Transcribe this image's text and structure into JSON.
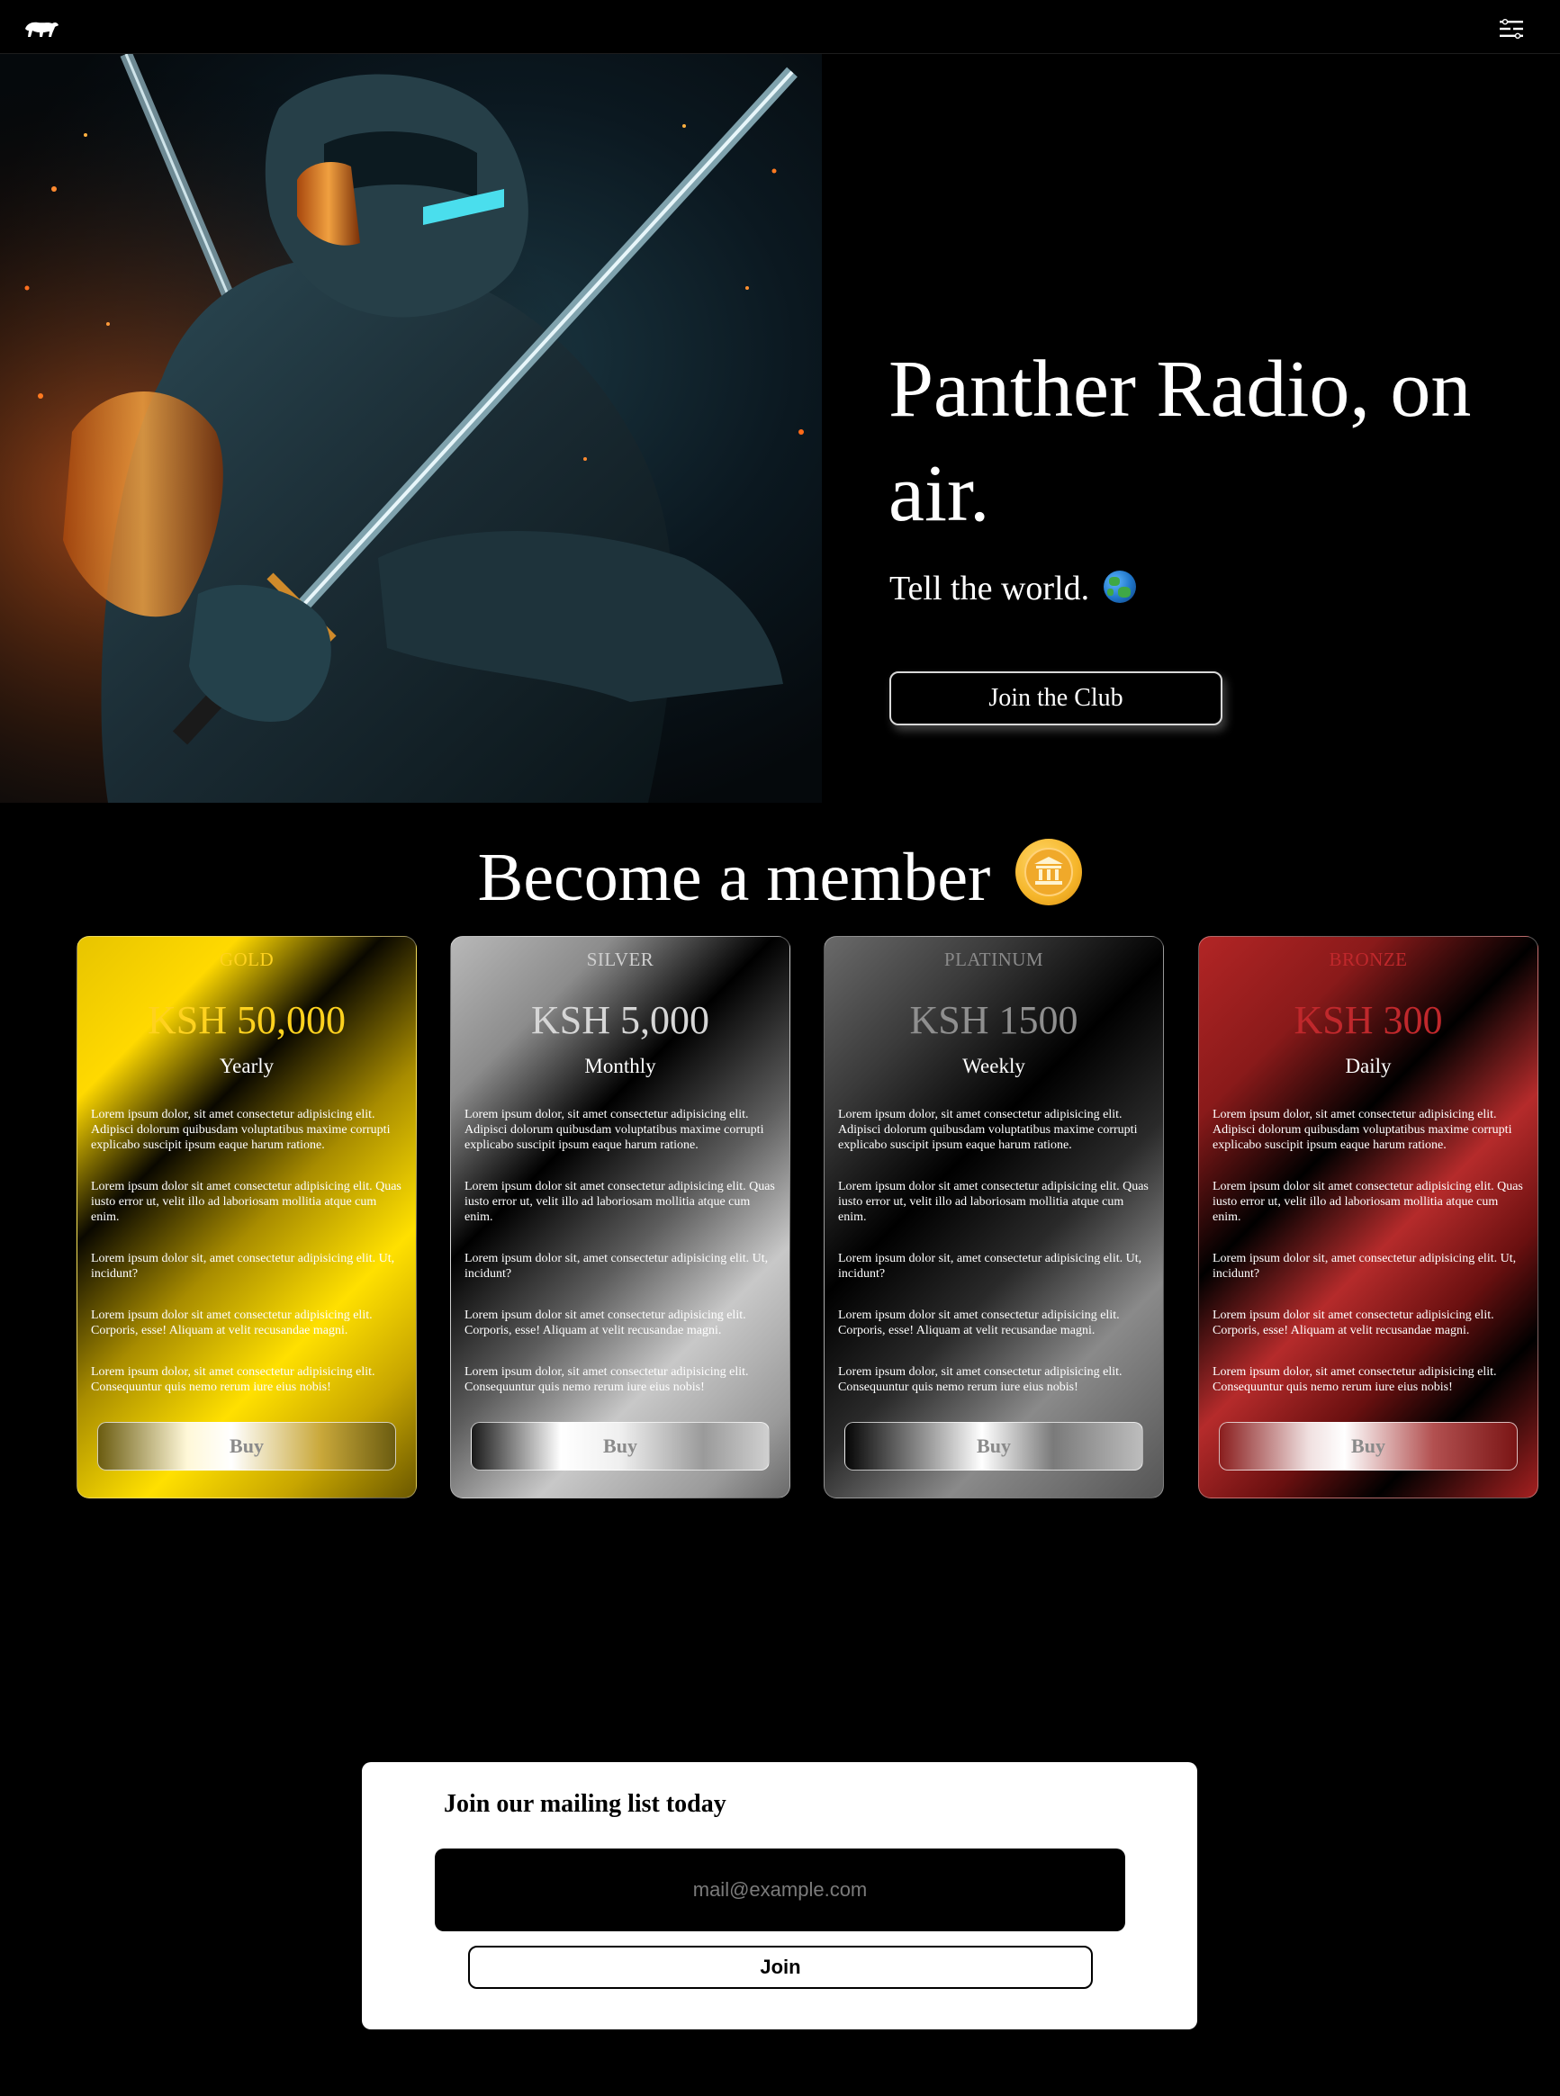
{
  "nav": {
    "logo_icon": "panther-logo-icon",
    "menu_icon": "menu-icon"
  },
  "hero": {
    "title": "Panther Radio, on air.",
    "subtitle": "Tell the world.",
    "subtitle_icon": "globe-icon",
    "cta_label": "Join the Club",
    "image_icon": "ninja-warrior-image"
  },
  "membership": {
    "title": "Become a member",
    "title_icon": "bank-coin-icon",
    "plans": [
      {
        "tier": "GOLD",
        "price": "KSH 50,000",
        "period": "Yearly",
        "color": "#ffd21f",
        "buy_label": "Buy",
        "paragraphs": [
          "Lorem ipsum dolor, sit amet consectetur adipisicing elit. Adipisci dolorum quibusdam voluptatibus maxime corrupti explicabo suscipit ipsum eaque harum ratione.",
          "Lorem ipsum dolor sit amet consectetur adipisicing elit. Quas iusto error ut, velit illo ad laboriosam mollitia atque cum enim.",
          "Lorem ipsum dolor sit, amet consectetur adipisicing elit. Ut, incidunt?",
          "Lorem ipsum dolor sit amet consectetur adipisicing elit. Corporis, esse! Aliquam at velit recusandae magni.",
          "Lorem ipsum dolor, sit amet consectetur adipisicing elit. Consequuntur quis nemo rerum iure eius nobis!"
        ]
      },
      {
        "tier": "SILVER",
        "price": "KSH 5,000",
        "period": "Monthly",
        "color": "#cfcfcf",
        "buy_label": "Buy",
        "paragraphs": [
          "Lorem ipsum dolor, sit amet consectetur adipisicing elit. Adipisci dolorum quibusdam voluptatibus maxime corrupti explicabo suscipit ipsum eaque harum ratione.",
          "Lorem ipsum dolor sit amet consectetur adipisicing elit. Quas iusto error ut, velit illo ad laboriosam mollitia atque cum enim.",
          "Lorem ipsum dolor sit, amet consectetur adipisicing elit. Ut, incidunt?",
          "Lorem ipsum dolor sit amet consectetur adipisicing elit. Corporis, esse! Aliquam at velit recusandae magni.",
          "Lorem ipsum dolor, sit amet consectetur adipisicing elit. Consequuntur quis nemo rerum iure eius nobis!"
        ]
      },
      {
        "tier": "PLATINUM",
        "price": "KSH 1500",
        "period": "Weekly",
        "color": "#8a8a8a",
        "buy_label": "Buy",
        "paragraphs": [
          "Lorem ipsum dolor, sit amet consectetur adipisicing elit. Adipisci dolorum quibusdam voluptatibus maxime corrupti explicabo suscipit ipsum eaque harum ratione.",
          "Lorem ipsum dolor sit amet consectetur adipisicing elit. Quas iusto error ut, velit illo ad laboriosam mollitia atque cum enim.",
          "Lorem ipsum dolor sit, amet consectetur adipisicing elit. Ut, incidunt?",
          "Lorem ipsum dolor sit amet consectetur adipisicing elit. Corporis, esse! Aliquam at velit recusandae magni.",
          "Lorem ipsum dolor, sit amet consectetur adipisicing elit. Consequuntur quis nemo rerum iure eius nobis!"
        ]
      },
      {
        "tier": "BRONZE",
        "price": "KSH 300",
        "period": "Daily",
        "color": "#c0282c",
        "buy_label": "Buy",
        "paragraphs": [
          "Lorem ipsum dolor, sit amet consectetur adipisicing elit. Adipisci dolorum quibusdam voluptatibus maxime corrupti explicabo suscipit ipsum eaque harum ratione.",
          "Lorem ipsum dolor sit amet consectetur adipisicing elit. Quas iusto error ut, velit illo ad laboriosam mollitia atque cum enim.",
          "Lorem ipsum dolor sit, amet consectetur adipisicing elit. Ut, incidunt?",
          "Lorem ipsum dolor sit amet consectetur adipisicing elit. Corporis, esse! Aliquam at velit recusandae magni.",
          "Lorem ipsum dolor, sit amet consectetur adipisicing elit. Consequuntur quis nemo rerum iure eius nobis!"
        ]
      }
    ]
  },
  "mailing": {
    "title": "Join our mailing list today",
    "email_placeholder": "mail@example.com",
    "email_value": "",
    "join_label": "Join"
  },
  "colors": {
    "background": "#000000",
    "gold": "#ffd21f",
    "silver": "#cfcfcf",
    "platinum": "#8a8a8a",
    "bronze": "#c0282c"
  }
}
